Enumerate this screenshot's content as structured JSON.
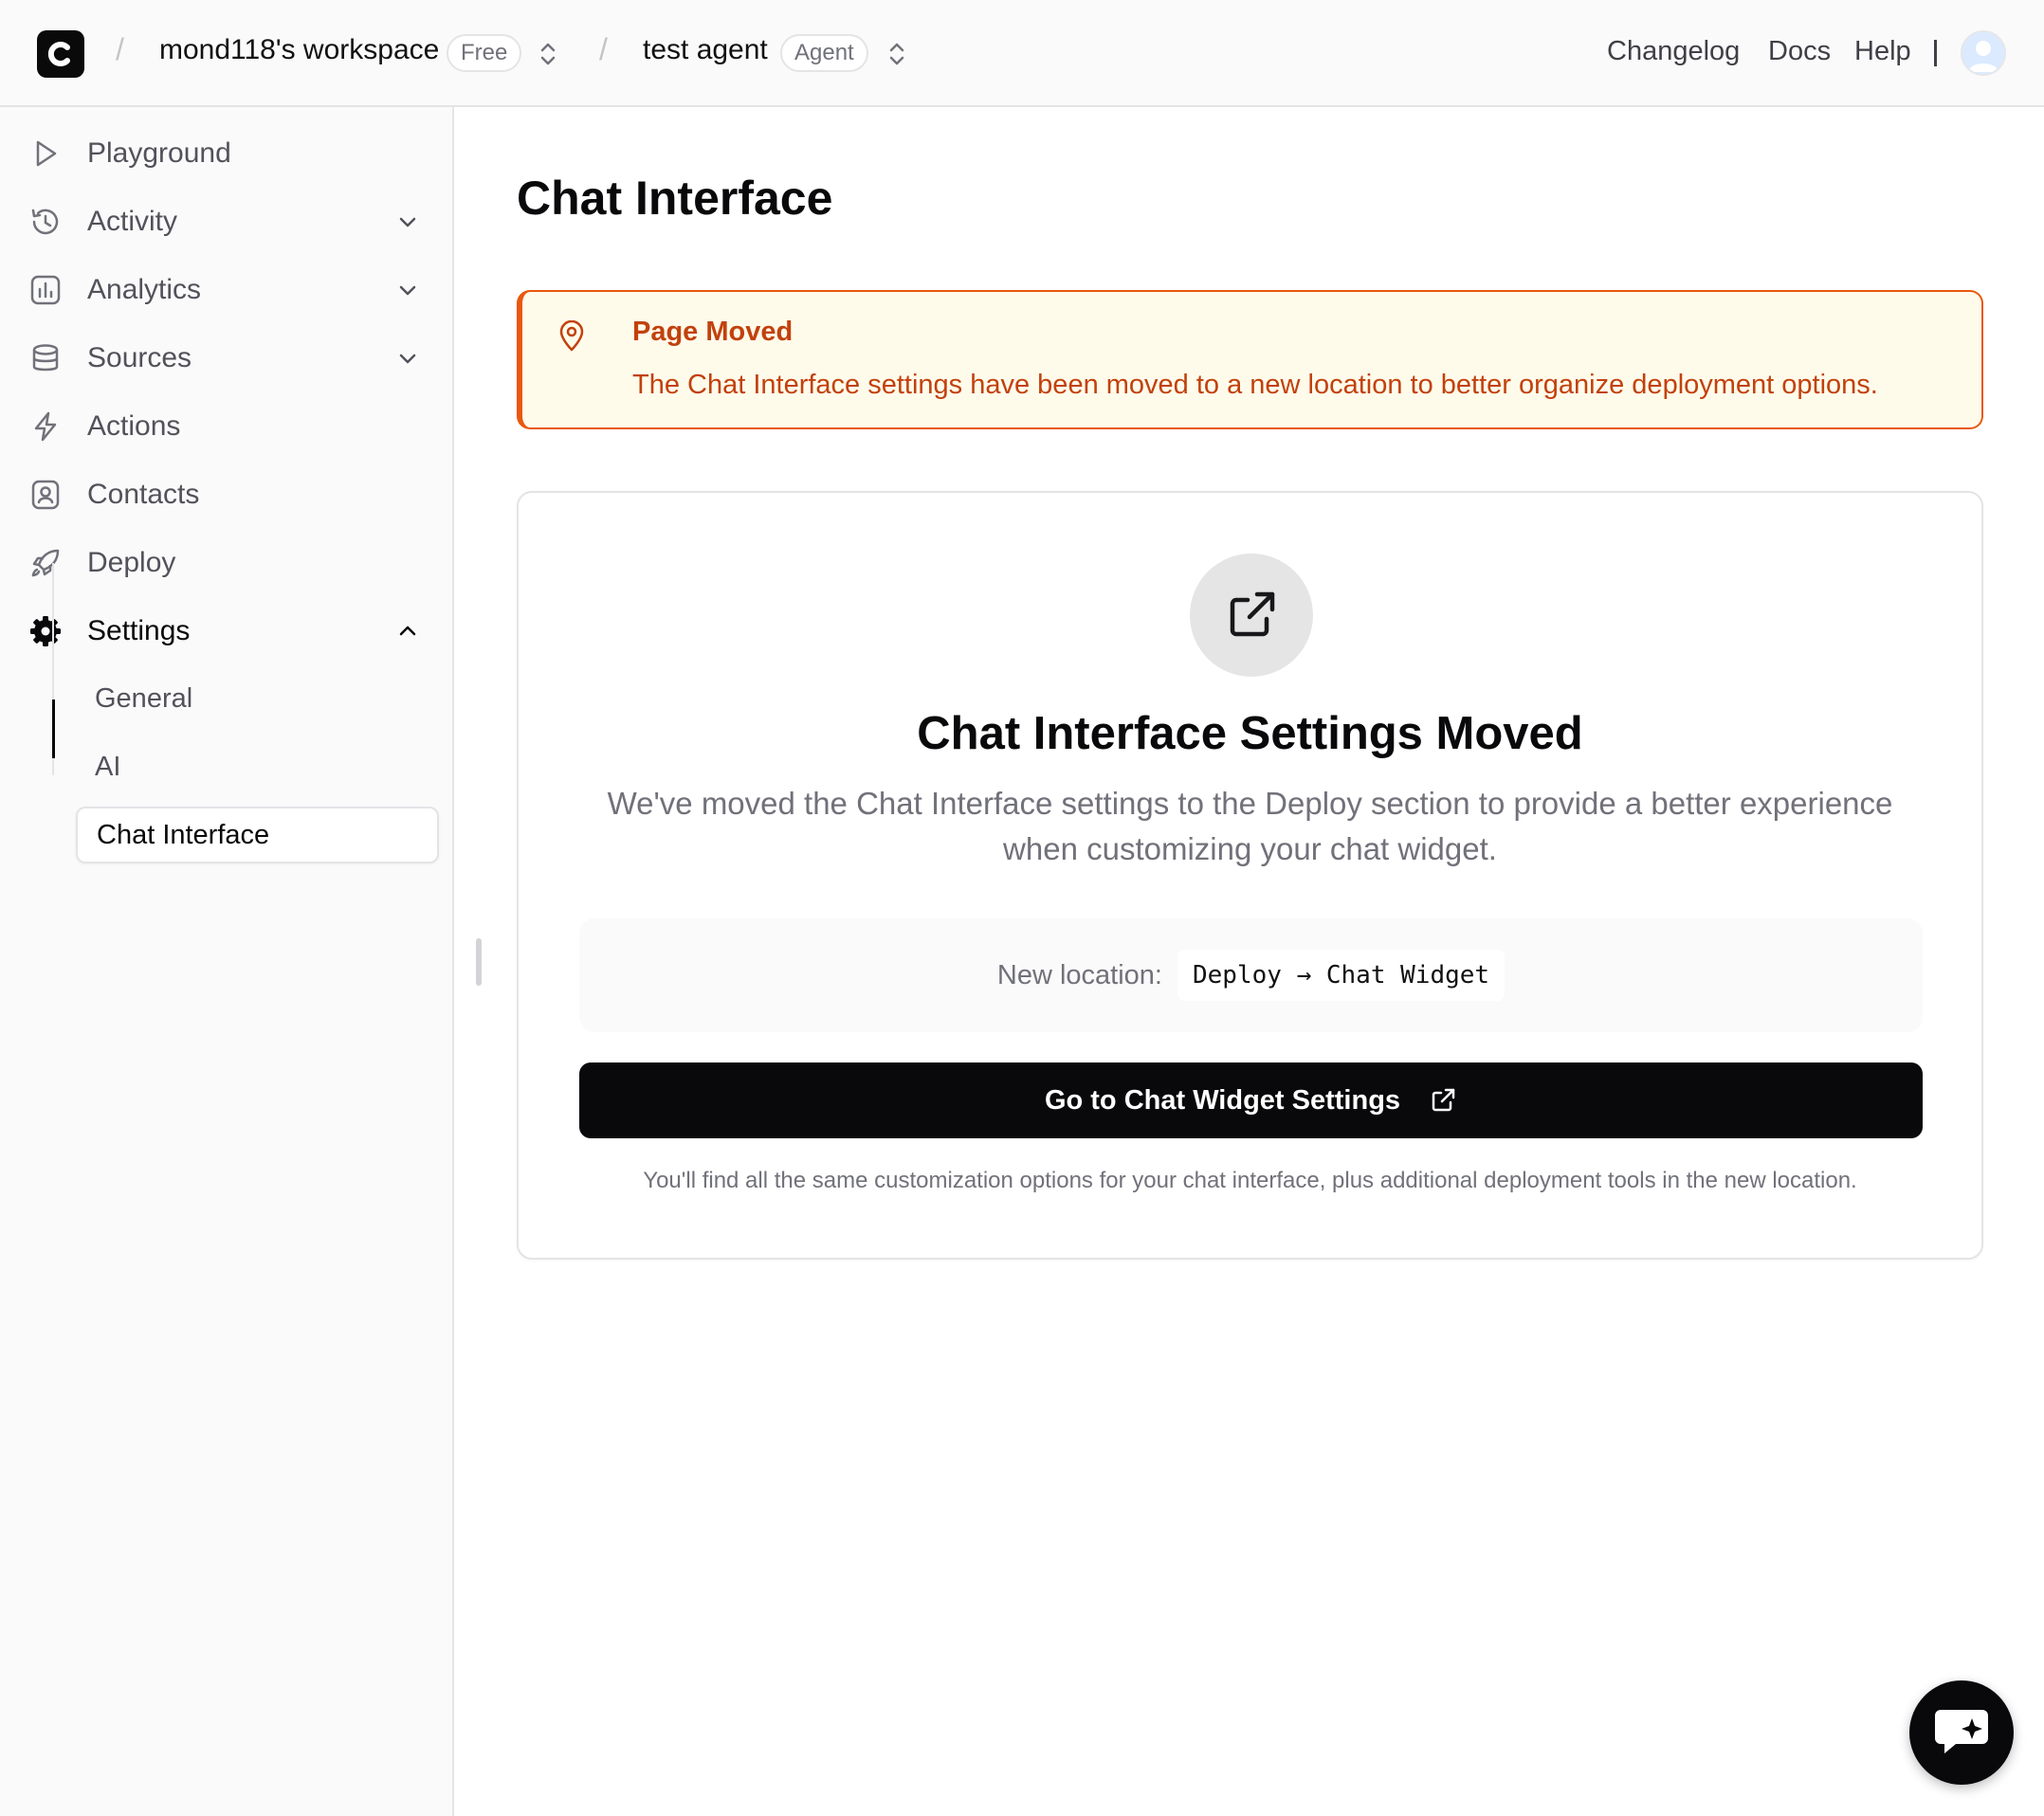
{
  "topbar": {
    "logo_letter": "C",
    "workspace_name": "mond118's workspace",
    "workspace_plan": "Free",
    "agent_name": "test agent",
    "agent_badge": "Agent",
    "links": [
      "Changelog",
      "Docs",
      "Help"
    ],
    "separator": "/"
  },
  "sidebar": {
    "items": [
      {
        "label": "Playground",
        "icon": "play-icon"
      },
      {
        "label": "Activity",
        "icon": "history-icon",
        "expandable": true
      },
      {
        "label": "Analytics",
        "icon": "bar-chart-icon",
        "expandable": true
      },
      {
        "label": "Sources",
        "icon": "database-icon",
        "expandable": true
      },
      {
        "label": "Actions",
        "icon": "lightning-icon"
      },
      {
        "label": "Contacts",
        "icon": "contact-icon"
      },
      {
        "label": "Deploy",
        "icon": "rocket-icon"
      },
      {
        "label": "Settings",
        "icon": "gear-icon",
        "expanded": true
      }
    ],
    "settings_subitems": [
      {
        "label": "General"
      },
      {
        "label": "AI"
      },
      {
        "label": "Chat Interface",
        "active": true
      }
    ]
  },
  "main": {
    "page_title": "Chat Interface",
    "alert": {
      "title": "Page Moved",
      "body": "The Chat Interface settings have been moved to a new location to better organize deployment options.",
      "color": "#c2410c",
      "background": "#fffbeb"
    },
    "card": {
      "title": "Chat Interface Settings Moved",
      "description": "We've moved the Chat Interface settings to the Deploy section to provide a better experience when customizing your chat widget.",
      "location_label": "New location:",
      "location_value": "Deploy → Chat Widget",
      "button_label": "Go to Chat Widget Settings",
      "footnote": "You'll find all the same customization options for your chat interface, plus additional deployment tools in the new location."
    }
  }
}
